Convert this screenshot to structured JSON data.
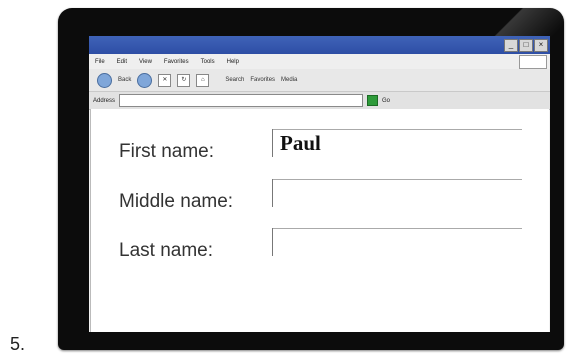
{
  "question_number": "5.",
  "window": {
    "controls": [
      "_",
      "□",
      "×"
    ]
  },
  "menu": [
    "File",
    "Edit",
    "View",
    "Favorites",
    "Tools",
    "Help"
  ],
  "toolbar": {
    "back_label": "Back",
    "search_label": "Search",
    "favorites_label": "Favorites",
    "media_label": "Media"
  },
  "address_bar": {
    "label": "Address",
    "value": "",
    "go_label": "Go"
  },
  "form": {
    "first_name_label": "First name:",
    "first_name_value": "Paul",
    "middle_name_label": "Middle name:",
    "middle_name_value": "",
    "last_name_label": "Last name:",
    "last_name_value": ""
  }
}
